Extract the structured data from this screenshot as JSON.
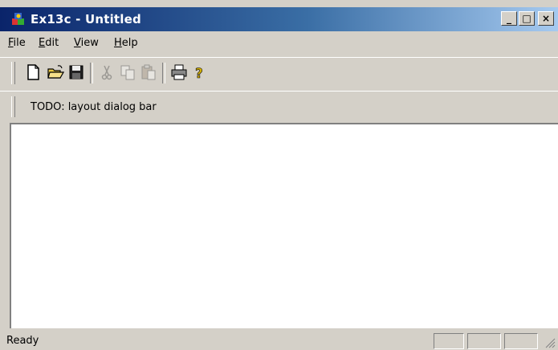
{
  "window": {
    "title": "Ex13c - Untitled",
    "caption_buttons": {
      "minimize": "_",
      "maximize": "□",
      "close": "×"
    }
  },
  "menu": {
    "items": [
      "File",
      "Edit",
      "View",
      "Help"
    ]
  },
  "toolbar": {
    "buttons": [
      {
        "icon": "new-file-icon",
        "enabled": true
      },
      {
        "icon": "open-folder-icon",
        "enabled": true
      },
      {
        "icon": "save-disk-icon",
        "enabled": true
      },
      {
        "icon": "cut-scissors-icon",
        "enabled": false
      },
      {
        "icon": "copy-icon",
        "enabled": false
      },
      {
        "icon": "paste-icon",
        "enabled": false
      },
      {
        "icon": "printer-icon",
        "enabled": true
      },
      {
        "icon": "help-question-icon",
        "enabled": true
      }
    ]
  },
  "dialog_bar": {
    "text": "TODO: layout dialog bar"
  },
  "status_bar": {
    "text": "Ready"
  },
  "colors": {
    "title_gradient_start": "#0a246a",
    "title_gradient_end": "#a6caf0",
    "chrome": "#d4d0c8",
    "client_bg": "#ffffff"
  }
}
